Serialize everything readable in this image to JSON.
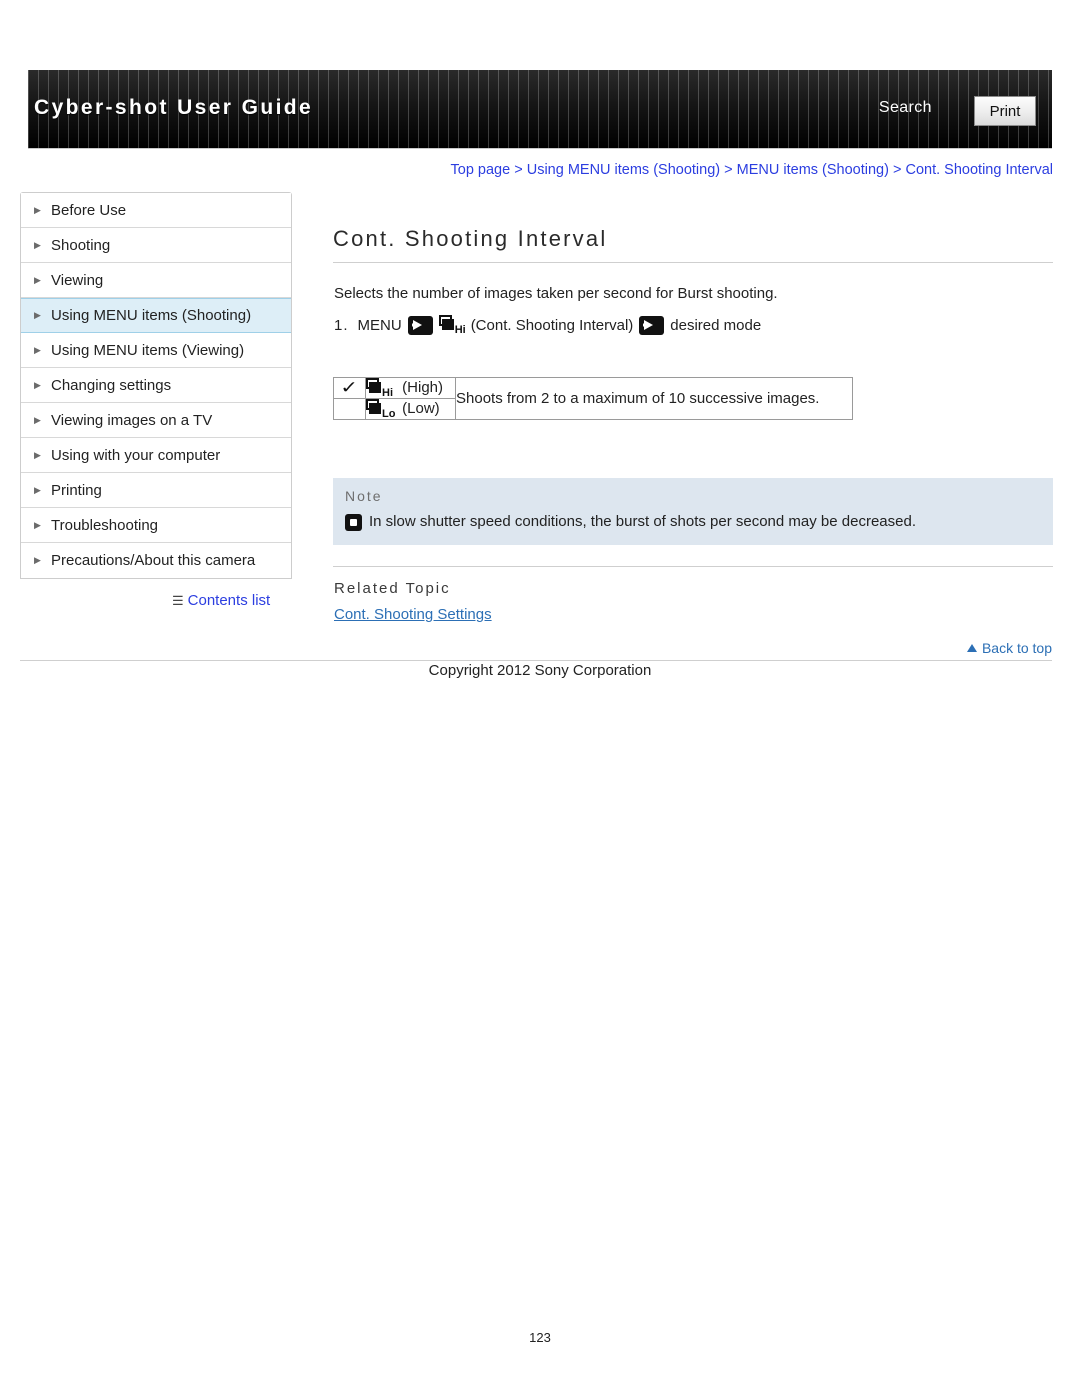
{
  "header": {
    "brand": "Cyber-shot User Guide",
    "search_label": "Search",
    "print_label": "Print"
  },
  "breadcrumb": {
    "items": [
      "Top page",
      "Using MENU items (Shooting)",
      "MENU items (Shooting)",
      "Cont. Shooting Interval"
    ],
    "separator": ">"
  },
  "sidebar": {
    "items": [
      {
        "label": "Before Use",
        "active": false
      },
      {
        "label": "Shooting",
        "active": false
      },
      {
        "label": "Viewing",
        "active": false
      },
      {
        "label": "Using MENU items (Shooting)",
        "active": true
      },
      {
        "label": "Using MENU items (Viewing)",
        "active": false
      },
      {
        "label": "Changing settings",
        "active": false
      },
      {
        "label": "Viewing images on a TV",
        "active": false
      },
      {
        "label": "Using with your computer",
        "active": false
      },
      {
        "label": "Printing",
        "active": false
      },
      {
        "label": "Troubleshooting",
        "active": false
      },
      {
        "label": "Precautions/About this camera",
        "active": false
      }
    ],
    "contents_list_label": "Contents list"
  },
  "main": {
    "title": "Cont. Shooting Interval",
    "intro": "Selects the number of images taken per second for Burst shooting.",
    "step": {
      "number": "1.",
      "menu_label": "MENU",
      "icon_tag": "Hi",
      "item_label": "(Cont. Shooting Interval)",
      "tail_label": "desired mode"
    },
    "options": [
      {
        "checked": true,
        "tag": "Hi",
        "label": "(High)",
        "desc": "Shoots from 2 to a maximum of 10 successive images."
      },
      {
        "checked": false,
        "tag": "Lo",
        "label": "(Low)",
        "desc": ""
      }
    ],
    "note": {
      "title": "Note",
      "text": "In slow shutter speed conditions, the burst of shots per second may be decreased."
    },
    "related": {
      "title": "Related Topic",
      "link": "Cont. Shooting Settings"
    },
    "back_to_top": "Back to top",
    "copyright": "Copyright 2012 Sony Corporation",
    "page_number": "123"
  }
}
